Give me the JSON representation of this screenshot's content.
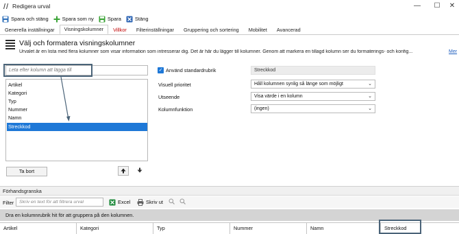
{
  "window": {
    "title": "Redigera urval",
    "controls": {
      "minimize": "—",
      "maximize": "☐",
      "close": "✕"
    }
  },
  "toolbar": {
    "save_close": "Spara och stäng",
    "save_as_new": "Spara som ny",
    "save": "Spara",
    "close": "Stäng"
  },
  "tabs": [
    {
      "label": "Generella inställningar",
      "active": false
    },
    {
      "label": "Visningskolumner",
      "active": true
    },
    {
      "label": "Villkor",
      "active": false,
      "color": "#c00000"
    },
    {
      "label": "Filterinställningar",
      "active": false
    },
    {
      "label": "Gruppering och sortering",
      "active": false
    },
    {
      "label": "Mobilitet",
      "active": false
    },
    {
      "label": "Avancerad",
      "active": false
    }
  ],
  "section": {
    "title": "Välj och formatera visningskolumner",
    "description": "Urvalet är en lista med flera kolumner som visar information som intresserar dig. Det är här du lägger till kolumner. Genom att markera en tillagd kolumn ser du formaterings- och konfig...",
    "more_link": "Mer"
  },
  "column_picker": {
    "search_placeholder": "Leta efter kolumn att lägga till",
    "columns": [
      "Artikel",
      "Kategori",
      "Typ",
      "Nummer",
      "Namn",
      "Streckkod"
    ],
    "selected": "Streckkod",
    "remove_button": "Ta bort",
    "move_up_icon": "arrow-up-icon",
    "move_down_icon": "arrow-down-icon"
  },
  "column_settings": {
    "use_default_header_label": "Använd standardrubrik",
    "use_default_header_checked": true,
    "header_value": "Streckkod",
    "visual_priority_label": "Visuell prioritet",
    "visual_priority_value": "Håll kolumnen synlig så länge som möjligt",
    "appearance_label": "Utseende",
    "appearance_value": "Visa värde i en kolumn",
    "column_function_label": "Kolumnfunktion",
    "column_function_value": "(ingen)"
  },
  "preview": {
    "header": "Förhandsgranska",
    "filter_label": "Filter",
    "filter_placeholder": "Skriv en text för att filtrera urval",
    "excel_button": "Excel",
    "print_button": "Skriv ut",
    "group_hint": "Dra en kolumnrubrik hit för att gruppera på den kolumnen.",
    "columns": [
      "Artikel",
      "Kategori",
      "Typ",
      "Nummer",
      "Namn",
      "Streckkod"
    ]
  },
  "colors": {
    "accent": "#1e78d7",
    "highlight_box": "#4a6378",
    "tab_warning": "#c00000"
  }
}
